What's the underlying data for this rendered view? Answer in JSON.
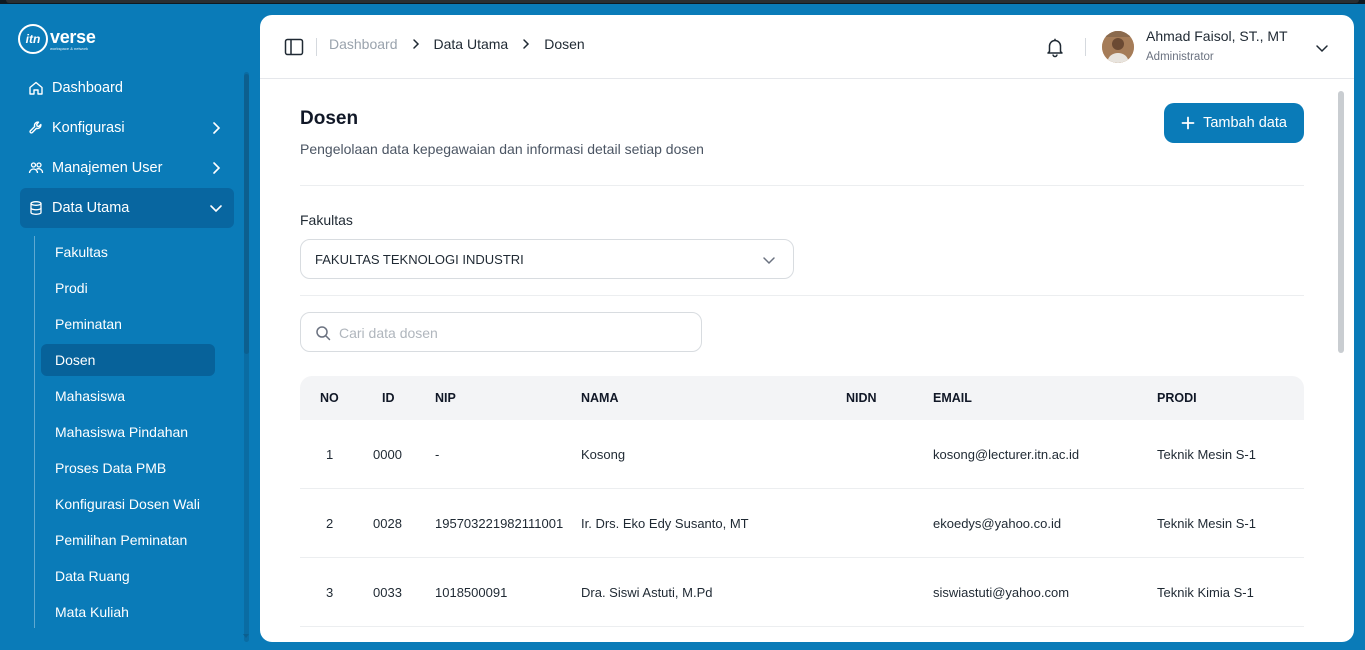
{
  "app": {
    "logo_mark": "itn",
    "logo_text": "verse",
    "logo_tagline": "workspace & network"
  },
  "sidebar": {
    "items": [
      {
        "label": "Dashboard",
        "icon": "home-icon"
      },
      {
        "label": "Konfigurasi",
        "icon": "wrench-icon"
      },
      {
        "label": "Manajemen User",
        "icon": "users-icon"
      },
      {
        "label": "Data Utama",
        "icon": "database-icon"
      }
    ],
    "sub_items": [
      "Fakultas",
      "Prodi",
      "Peminatan",
      "Dosen",
      "Mahasiswa",
      "Mahasiswa Pindahan",
      "Proses Data PMB",
      "Konfigurasi Dosen Wali",
      "Pemilihan Peminatan",
      "Data Ruang",
      "Mata Kuliah"
    ],
    "active_sub": "Dosen"
  },
  "header": {
    "breadcrumb": [
      "Dashboard",
      "Data Utama",
      "Dosen"
    ],
    "user_name": "Ahmad Faisol, ST., MT",
    "user_role": "Administrator"
  },
  "page": {
    "title": "Dosen",
    "description": "Pengelolaan data kepegawaian dan informasi detail setiap dosen",
    "add_button": "Tambah data"
  },
  "filter": {
    "label": "Fakultas",
    "selected": "FAKULTAS TEKNOLOGI INDUSTRI"
  },
  "search": {
    "placeholder": "Cari data dosen",
    "value": ""
  },
  "table": {
    "columns": [
      "NO",
      "ID",
      "NIP",
      "NAMA",
      "NIDN",
      "EMAIL",
      "PRODI"
    ],
    "rows": [
      {
        "no": "1",
        "id": "0000",
        "nip": "-",
        "nama": "Kosong",
        "nidn": "",
        "email": "kosong@lecturer.itn.ac.id",
        "prodi": "Teknik Mesin S-1"
      },
      {
        "no": "2",
        "id": "0028",
        "nip": "195703221982111001",
        "nama": "Ir. Drs. Eko Edy Susanto, MT",
        "nidn": "",
        "email": "ekoedys@yahoo.co.id",
        "prodi": "Teknik Mesin S-1"
      },
      {
        "no": "3",
        "id": "0033",
        "nip": "1018500091",
        "nama": "Dra. Siswi Astuti, M.Pd",
        "nidn": "",
        "email": "siswiastuti@yahoo.com",
        "prodi": "Teknik Kimia S-1"
      }
    ]
  },
  "colors": {
    "brand": "#0a7bb8",
    "sidebar_active": "#07629a",
    "table_header_bg": "#f3f4f6"
  }
}
